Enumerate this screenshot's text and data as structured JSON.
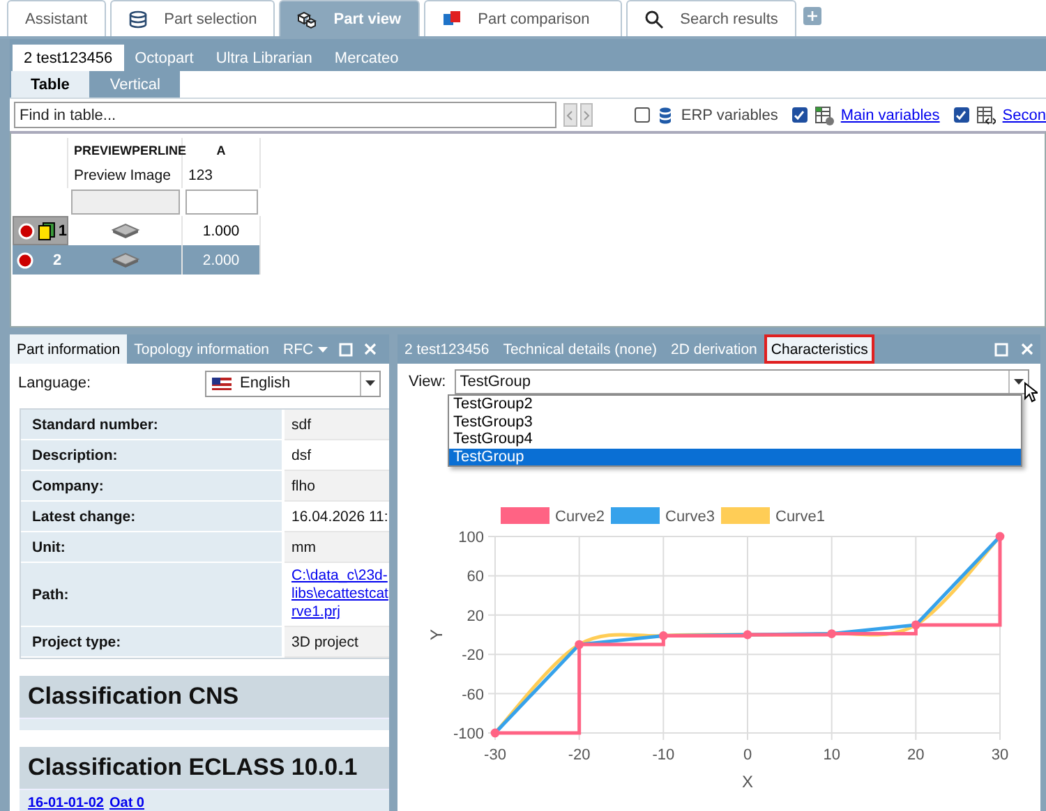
{
  "top_tabs": [
    {
      "label": "Assistant",
      "selected": false
    },
    {
      "label": "Part selection",
      "selected": false
    },
    {
      "label": "Part view",
      "selected": true
    },
    {
      "label": "Part comparison",
      "selected": false
    },
    {
      "label": "Search results",
      "selected": false
    }
  ],
  "doc_tabs": [
    {
      "label": "2 test123456",
      "selected": true
    },
    {
      "label": "Octopart",
      "selected": false
    },
    {
      "label": "Ultra Librarian",
      "selected": false
    },
    {
      "label": "Mercateo",
      "selected": false
    }
  ],
  "view_tabs": [
    {
      "label": "Table",
      "selected": true
    },
    {
      "label": "Vertical",
      "selected": false
    }
  ],
  "search": {
    "placeholder": "Find in table..."
  },
  "toggles": [
    {
      "label": "ERP variables",
      "checked": false,
      "kind": "text"
    },
    {
      "label": "Main variables",
      "checked": true,
      "kind": "link"
    },
    {
      "label": "Secon",
      "checked": true,
      "kind": "link"
    }
  ],
  "table": {
    "columns": [
      {
        "name": "PREVIEWPERLINE",
        "description": "Preview Image"
      },
      {
        "name": "A",
        "description": "123"
      }
    ],
    "rows": [
      {
        "number": "1",
        "value": "1.000",
        "selected": false,
        "current": true
      },
      {
        "number": "2",
        "value": "2.000",
        "selected": true,
        "current": false
      }
    ]
  },
  "left_panel": {
    "tabs": [
      {
        "label": "Part information",
        "selected": true
      },
      {
        "label": "Topology information",
        "selected": false
      },
      {
        "label": "RFC",
        "selected": false
      }
    ],
    "language": {
      "label": "Language:",
      "value": "English"
    },
    "info": [
      {
        "label": "Standard number:",
        "value": "sdf",
        "kind": "text"
      },
      {
        "label": "Description:",
        "value": "dsf",
        "kind": "text"
      },
      {
        "label": "Company:",
        "value": "flho",
        "kind": "text"
      },
      {
        "label": "Latest change:",
        "value": "16.04.2026 11:",
        "kind": "text"
      },
      {
        "label": "Unit:",
        "value": "mm",
        "kind": "text"
      },
      {
        "label": "Path:",
        "value": "C:\\data_c\\23d-\nlibs\\ecattestcat\nrve1.prj",
        "kind": "link"
      },
      {
        "label": "Project type:",
        "value": "3D project",
        "kind": "text"
      }
    ],
    "classifications": [
      {
        "title": "Classification CNS"
      },
      {
        "title": "Classification ECLASS 10.0.1",
        "links": [
          "16-01-01-02",
          "Oat 0"
        ]
      }
    ]
  },
  "right_panel": {
    "tabs": [
      {
        "label": "2 test123456",
        "selected": false
      },
      {
        "label": "Technical details (none)",
        "selected": false
      },
      {
        "label": "2D derivation",
        "selected": false
      },
      {
        "label": "Characteristics",
        "selected": true
      }
    ],
    "view": {
      "label": "View:",
      "value": "TestGroup",
      "options": [
        {
          "label": "TestGroup2",
          "selected": false
        },
        {
          "label": "TestGroup3",
          "selected": false
        },
        {
          "label": "TestGroup4",
          "selected": false
        },
        {
          "label": "TestGroup",
          "selected": true
        }
      ]
    },
    "chart_data": {
      "type": "line",
      "xlabel": "X",
      "ylabel": "Y",
      "x": [
        -30,
        -20,
        -20,
        -10,
        -10,
        0,
        0,
        10,
        10,
        20,
        20,
        30,
        30
      ],
      "series": [
        {
          "name": "Curve2",
          "color": "#ff6384",
          "marker": "circle",
          "values": [
            -100,
            -100,
            -10,
            -10,
            -1,
            -1,
            0,
            0,
            1,
            1,
            10,
            10,
            100
          ]
        },
        {
          "name": "Curve3",
          "color": "#36a2eb",
          "values": [
            -100,
            -10,
            -10,
            -1,
            -1,
            0,
            0,
            1,
            1,
            10,
            10,
            100,
            100
          ]
        },
        {
          "name": "Curve1",
          "color": "#ffcd56",
          "values": [
            -100,
            -10,
            -10,
            -1,
            -1,
            0,
            0,
            1,
            1,
            10,
            10,
            100,
            100
          ]
        }
      ],
      "grid": true,
      "legend": true,
      "xlim": [
        -30,
        30
      ],
      "ylim": [
        -100,
        100
      ],
      "xticks": [
        -30,
        -20,
        -10,
        0,
        10,
        20,
        30
      ],
      "yticks": [
        100,
        60,
        20,
        -20,
        -60,
        -100
      ]
    }
  }
}
